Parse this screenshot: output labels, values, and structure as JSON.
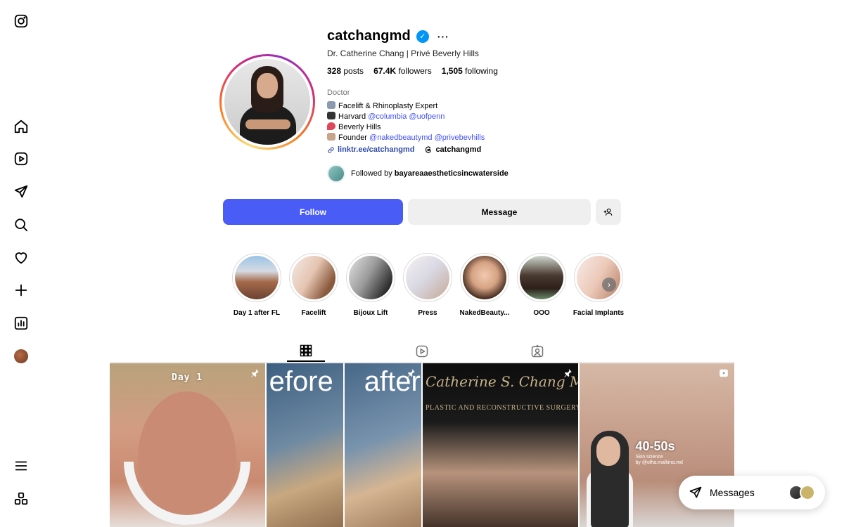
{
  "profile": {
    "username": "catchangmd",
    "fullname": "Dr. Catherine Chang | Privé Beverly Hills",
    "stats": {
      "posts_count": "328",
      "posts_label": "posts",
      "followers_count": "67.4K",
      "followers_label": "followers",
      "following_count": "1,505",
      "following_label": "following"
    },
    "category": "Doctor",
    "bio": {
      "line1": "Facelift & Rhinoplasty Expert",
      "line2_prefix": "Harvard",
      "line2_mention1": "@columbia",
      "line2_mention2": "@uofpenn",
      "line3": "Beverly Hills",
      "line4_prefix": "Founder",
      "line4_mention1": "@nakedbeautymd",
      "line4_mention2": "@privebevhills"
    },
    "link": "linktr.ee/catchangmd",
    "threads": "catchangmd",
    "followed_by_prefix": "Followed by",
    "followed_by_user": "bayareaaestheticsincwaterside"
  },
  "actions": {
    "follow_label": "Follow",
    "message_label": "Message"
  },
  "highlights": [
    {
      "label": "Day 1 after FL"
    },
    {
      "label": "Facelift"
    },
    {
      "label": "Bijoux Lift"
    },
    {
      "label": "Press"
    },
    {
      "label": "NakedBeauty..."
    },
    {
      "label": "OOO"
    },
    {
      "label": "Facial Implants"
    }
  ],
  "tabs": {
    "posts": "grid-icon",
    "reels": "reels-icon",
    "tagged": "tagged-icon",
    "active": "posts"
  },
  "posts": [
    {
      "overlay": "Day 1",
      "badge": "pin-icon"
    },
    {
      "overlay_left": "efore",
      "overlay_right": "after",
      "badge": "pin-icon"
    },
    {
      "overlay_title": "Catherine S. Chang MD",
      "overlay_sub": "PLASTIC AND RECONSTRUCTIVE SURGERY",
      "badge": "pin-icon"
    },
    {
      "overlay": "40-50s",
      "overlay_sub": "Skin science\nby @olha.malkina.md",
      "badge": "reels-icon"
    }
  ],
  "messages": {
    "label": "Messages"
  },
  "colors": {
    "follow_button": "#4a5cf6",
    "verified": "#0095f6",
    "mention": "#4150f7",
    "secondary_button": "#efefef"
  }
}
